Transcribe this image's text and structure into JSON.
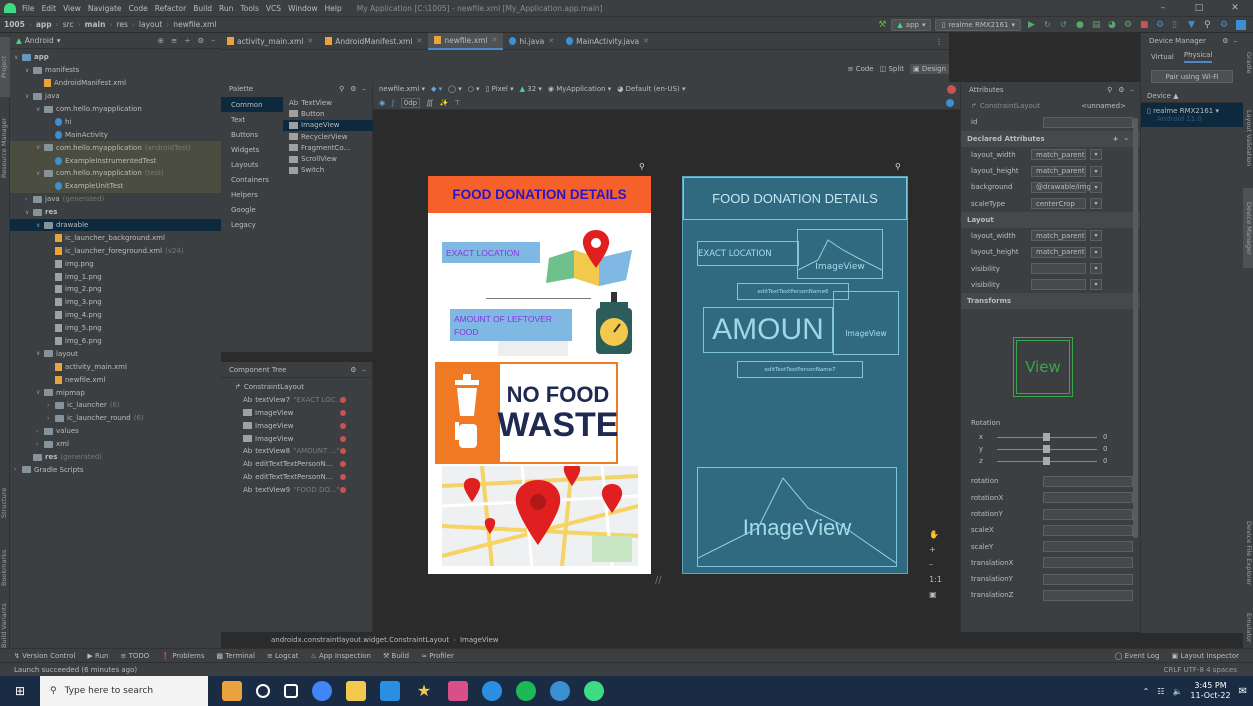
{
  "menu": {
    "items": [
      "File",
      "Edit",
      "View",
      "Navigate",
      "Code",
      "Refactor",
      "Build",
      "Run",
      "Tools",
      "VCS",
      "Window",
      "Help"
    ],
    "title": "My Application [C:\\1005] - newfile.xml [My_Application.app.main]"
  },
  "nav": {
    "crumbs": [
      "1005",
      "app",
      "src",
      "main",
      "res",
      "layout",
      "newfile.xml"
    ],
    "run_config": "app",
    "device": "realme RMX2161"
  },
  "project_panel": {
    "view": "Android",
    "tree": [
      {
        "label": "app",
        "indent": 0,
        "icon": "folder-blue",
        "arrow": "v"
      },
      {
        "label": "manifests",
        "indent": 1,
        "icon": "folder",
        "arrow": "v"
      },
      {
        "label": "AndroidManifest.xml",
        "indent": 2,
        "icon": "xml"
      },
      {
        "label": "java",
        "indent": 1,
        "icon": "folder",
        "arrow": "v"
      },
      {
        "label": "com.hello.myapplication",
        "indent": 2,
        "icon": "folder",
        "arrow": "v"
      },
      {
        "label": "hi",
        "indent": 3,
        "icon": "kt"
      },
      {
        "label": "MainActivity",
        "indent": 3,
        "icon": "kt"
      },
      {
        "label": "com.hello.myapplication",
        "hint": "(androidTest)",
        "indent": 2,
        "icon": "folder",
        "arrow": "v",
        "shaded": true
      },
      {
        "label": "ExampleInstrumentedTest",
        "indent": 3,
        "icon": "kt",
        "shaded": true
      },
      {
        "label": "com.hello.myapplication",
        "hint": "(test)",
        "indent": 2,
        "icon": "folder",
        "arrow": "v",
        "shaded": true
      },
      {
        "label": "ExampleUnitTest",
        "indent": 3,
        "icon": "kt",
        "shaded": true
      },
      {
        "label": "java",
        "hint": "(generated)",
        "indent": 1,
        "icon": "folder",
        "arrow": ">"
      },
      {
        "label": "res",
        "indent": 1,
        "icon": "folder",
        "arrow": "v"
      },
      {
        "label": "drawable",
        "indent": 2,
        "icon": "folder",
        "arrow": "v",
        "selected": true
      },
      {
        "label": "ic_launcher_background.xml",
        "indent": 3,
        "icon": "xml"
      },
      {
        "label": "ic_launcher_foreground.xml",
        "hint": "(v24)",
        "indent": 3,
        "icon": "xml"
      },
      {
        "label": "img.png",
        "indent": 3,
        "icon": "png"
      },
      {
        "label": "img_1.png",
        "indent": 3,
        "icon": "png"
      },
      {
        "label": "img_2.png",
        "indent": 3,
        "icon": "png"
      },
      {
        "label": "img_3.png",
        "indent": 3,
        "icon": "png"
      },
      {
        "label": "img_4.png",
        "indent": 3,
        "icon": "png"
      },
      {
        "label": "img_5.png",
        "indent": 3,
        "icon": "png"
      },
      {
        "label": "img_6.png",
        "indent": 3,
        "icon": "png"
      },
      {
        "label": "layout",
        "indent": 2,
        "icon": "folder",
        "arrow": "v"
      },
      {
        "label": "activity_main.xml",
        "indent": 3,
        "icon": "xml"
      },
      {
        "label": "newfile.xml",
        "indent": 3,
        "icon": "xml"
      },
      {
        "label": "mipmap",
        "indent": 2,
        "icon": "folder",
        "arrow": "v"
      },
      {
        "label": "ic_launcher",
        "hint": "(6)",
        "indent": 3,
        "icon": "folder",
        "arrow": ">"
      },
      {
        "label": "ic_launcher_round",
        "hint": "(6)",
        "indent": 3,
        "icon": "folder",
        "arrow": ">"
      },
      {
        "label": "values",
        "indent": 2,
        "icon": "folder",
        "arrow": ">"
      },
      {
        "label": "xml",
        "indent": 2,
        "icon": "folder",
        "arrow": ">"
      },
      {
        "label": "res",
        "hint": "(generated)",
        "indent": 1,
        "icon": "folder"
      },
      {
        "label": "Gradle Scripts",
        "indent": 0,
        "icon": "gradle",
        "arrow": ">"
      }
    ]
  },
  "tabs": [
    {
      "label": "activity_main.xml",
      "active": false
    },
    {
      "label": "AndroidManifest.xml",
      "active": false
    },
    {
      "label": "newfile.xml",
      "active": true
    },
    {
      "label": "hi.java",
      "active": false
    },
    {
      "label": "MainActivity.java",
      "active": false
    }
  ],
  "view_modes": [
    "Code",
    "Split",
    "Design"
  ],
  "palette": {
    "title": "Palette",
    "categories": [
      "Common",
      "Text",
      "Buttons",
      "Widgets",
      "Layouts",
      "Containers",
      "Helpers",
      "Google",
      "Legacy"
    ],
    "items": [
      {
        "label": "TextView",
        "prefix": "Ab"
      },
      {
        "label": "Button"
      },
      {
        "label": "ImageView",
        "selected": true
      },
      {
        "label": "RecyclerView"
      },
      {
        "label": "FragmentCo..."
      },
      {
        "label": "ScrollView"
      },
      {
        "label": "Switch"
      }
    ]
  },
  "design_toolbar": {
    "file": "newfile.xml",
    "device": "Pixel",
    "api": "32",
    "theme": "MyApplication",
    "locale": "Default (en-US)",
    "margin": "0dp"
  },
  "component_tree": {
    "title": "Component Tree",
    "items": [
      {
        "label": "ConstraintLayout",
        "root": true
      },
      {
        "label": "textView7",
        "hint": "\"EXACT LOC...\"",
        "prefix": "Ab"
      },
      {
        "label": "ImageView"
      },
      {
        "label": "ImageView"
      },
      {
        "label": "ImageView"
      },
      {
        "label": "textView8",
        "hint": "\"AMOUNT ...\"",
        "prefix": "Ab"
      },
      {
        "label": "editTextTextPersonN...",
        "prefix": "Ab"
      },
      {
        "label": "editTextTextPersonN...",
        "prefix": "Ab"
      },
      {
        "label": "textView9",
        "hint": "\"FOOD DO...\"",
        "prefix": "Ab"
      }
    ]
  },
  "phone": {
    "title": "FOOD DONATION DETAILS",
    "exact_location": "EXACT LOCATION",
    "amount": "AMOUNT OF LEFTOVER FOOD",
    "no_food": "NO FOOD",
    "waste": "WASTE"
  },
  "blueprint": {
    "title": "FOOD DONATION DETAILS",
    "exact_location": "EXACT LOCATION",
    "imageview": "ImageView",
    "edit1": "editTextTextPersonName6",
    "amoun": "AMOUN",
    "edit2": "editTextTextPersonName7",
    "imageview_big": "ImageView"
  },
  "attributes": {
    "title": "Attributes",
    "component": "ConstraintLayout",
    "component_id": "<unnamed>",
    "id_label": "id",
    "declared_title": "Declared Attributes",
    "declared": [
      {
        "k": "layout_width",
        "v": "match_parent"
      },
      {
        "k": "layout_height",
        "v": "match_parent"
      },
      {
        "k": "background",
        "v": "@drawable/img_2"
      },
      {
        "k": "scaleType",
        "v": "centerCrop"
      }
    ],
    "layout_title": "Layout",
    "layout": [
      {
        "k": "layout_width",
        "v": "match_parent"
      },
      {
        "k": "layout_height",
        "v": "match_parent"
      },
      {
        "k": "visibility",
        "v": ""
      },
      {
        "k": "visibility",
        "v": ""
      }
    ],
    "transforms_title": "Transforms",
    "view_label": "View",
    "rotation_label": "Rotation",
    "axes": [
      {
        "k": "x",
        "v": "0"
      },
      {
        "k": "y",
        "v": "0"
      },
      {
        "k": "z",
        "v": "0"
      }
    ],
    "more": [
      "rotation",
      "rotationX",
      "rotationY",
      "scaleX",
      "scaleY",
      "translationX",
      "translationY",
      "translationZ"
    ]
  },
  "device_manager": {
    "title": "Device Manager",
    "tabs": [
      "Virtual",
      "Physical"
    ],
    "pair": "Pair using Wi-Fi",
    "device_label": "Device",
    "device": "realme RMX2161",
    "android": "Android 11.0"
  },
  "breadcrumb_bottom": [
    "androidx.constraintlayout.widget.ConstraintLayout",
    "ImageView"
  ],
  "bottom_tools": [
    "Version Control",
    "Run",
    "TODO",
    "Problems",
    "Terminal",
    "Logcat",
    "App Inspection",
    "Build",
    "Profiler"
  ],
  "bottom_right": [
    "Event Log",
    "Layout Inspector"
  ],
  "status": {
    "message": "Launch succeeded (6 minutes ago)",
    "right": "CRLF  UTF-8  4 spaces"
  },
  "left_stripe": [
    "Project",
    "Resource Manager",
    "Structure",
    "Bookmarks",
    "Build Variants"
  ],
  "right_stripe": [
    "Gradle",
    "Layout Validation",
    "Device Manager",
    "Device File Explorer",
    "Emulator"
  ],
  "taskbar": {
    "search": "Type here to search",
    "time": "3:45 PM",
    "date": "11-Oct-22"
  }
}
